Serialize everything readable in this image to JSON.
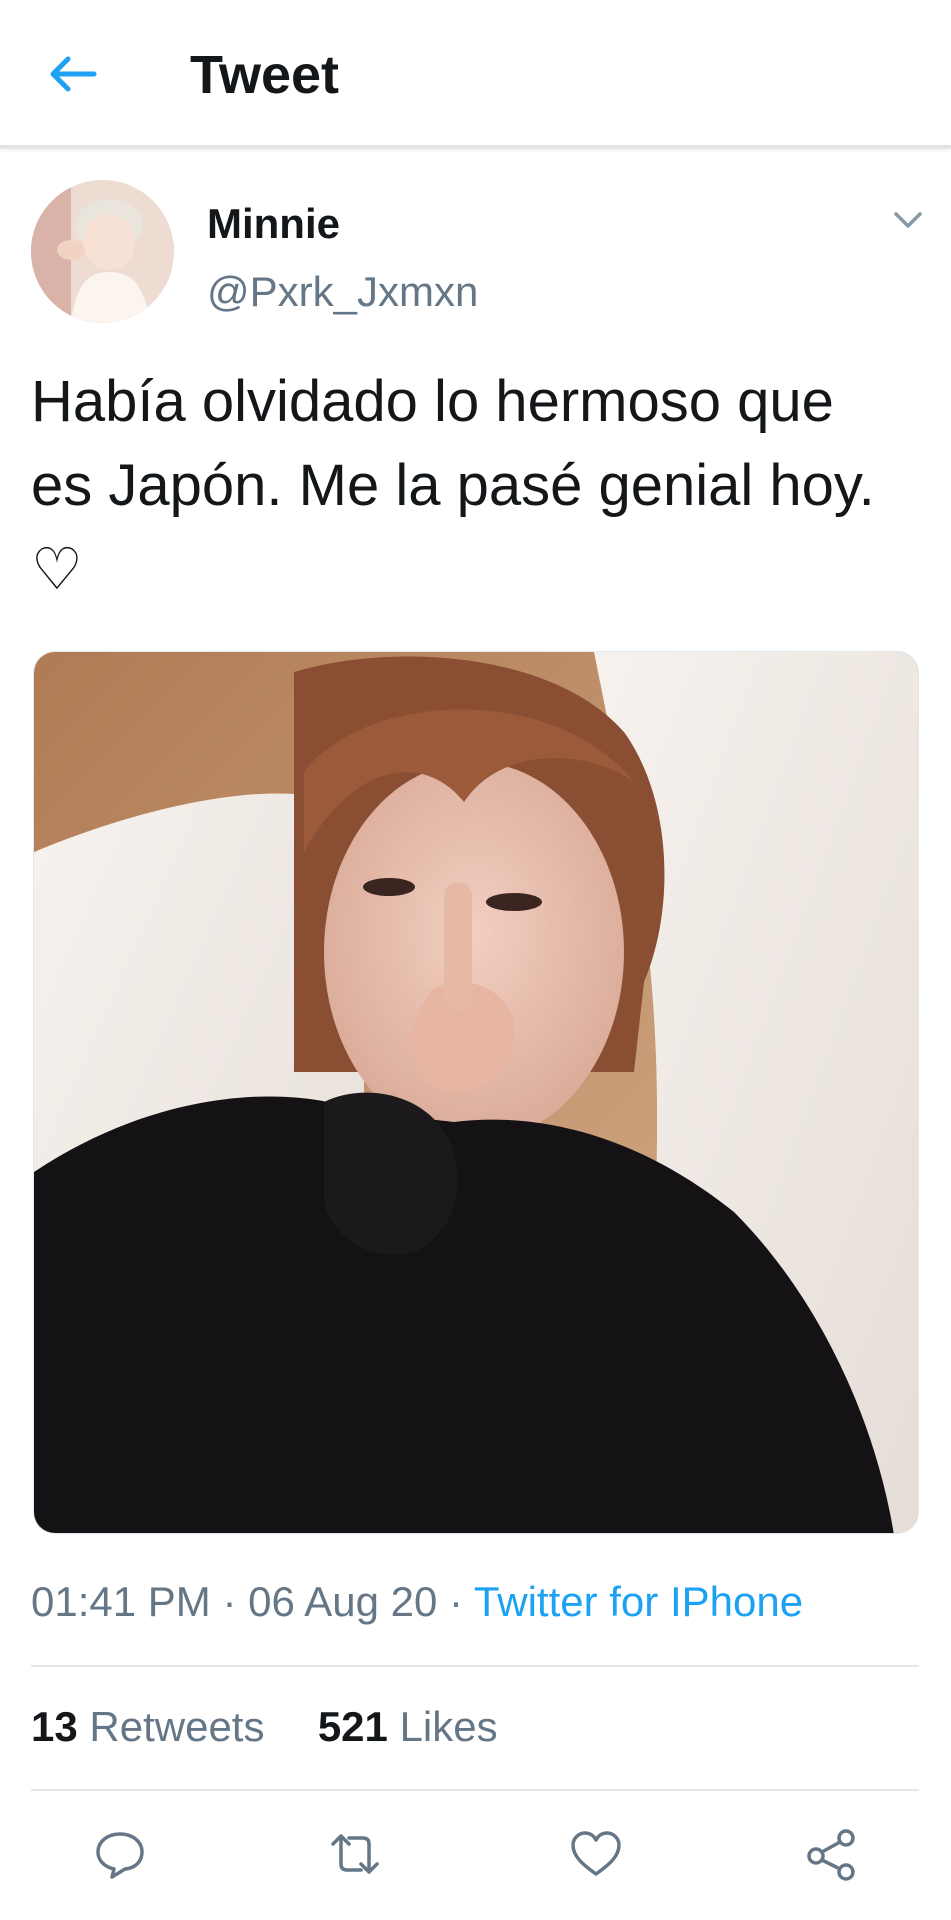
{
  "header": {
    "title": "Tweet",
    "back_icon": "arrow-left-icon",
    "accent": "#1da1f2"
  },
  "tweet": {
    "author_name": "Minnie",
    "author_handle": "@Pxrk_Jxmxn",
    "text": "Había olvidado lo hermoso que es Japón. Me la pasé genial hoy. ♡",
    "time": "01:41 PM",
    "date": "06 Aug 20",
    "separator": "·",
    "source": "Twitter for IPhone"
  },
  "stats": {
    "retweets_count": "13",
    "retweets_label": "Retweets",
    "likes_count": "521",
    "likes_label": "Likes"
  },
  "actions": [
    {
      "icon": "reply-icon"
    },
    {
      "icon": "retweet-icon"
    },
    {
      "icon": "like-icon"
    },
    {
      "icon": "share-icon"
    }
  ],
  "colors": {
    "primary_text": "#14171a",
    "secondary_text": "#657786",
    "link": "#1da1f2",
    "divider": "#e1e8ed"
  }
}
